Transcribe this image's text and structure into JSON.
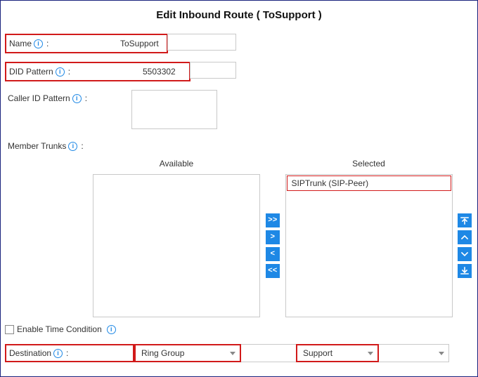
{
  "title": "Edit Inbound Route ( ToSupport )",
  "fields": {
    "name": {
      "label": "Name",
      "value": "ToSupport"
    },
    "did_pattern": {
      "label": "DID Pattern",
      "value": "5503302"
    },
    "callerid_pattern": {
      "label": "Caller ID Pattern",
      "value": ""
    },
    "member_trunks": {
      "label": "Member Trunks"
    }
  },
  "trunks": {
    "available_header": "Available",
    "selected_header": "Selected",
    "available": [],
    "selected": [
      "SIPTrunk (SIP-Peer)"
    ]
  },
  "enable_time_condition": {
    "label": "Enable Time Condition",
    "checked": false
  },
  "destination": {
    "label": "Destination",
    "type_value": "Ring Group",
    "target_value": "Support"
  }
}
